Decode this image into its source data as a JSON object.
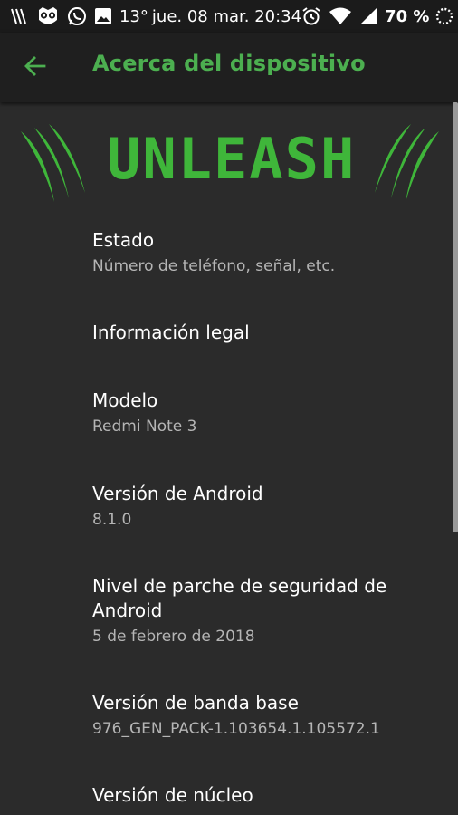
{
  "status_bar": {
    "temperature": "13°",
    "datetime": "jue. 08 mar. 20:34",
    "battery": "70 %",
    "icons": [
      "claw-icon",
      "owl-icon",
      "whatsapp-icon",
      "image-icon",
      "alarm-icon",
      "wifi-icon",
      "signal-icon",
      "loading-icon"
    ]
  },
  "app_bar": {
    "title": "Acerca del dispositivo",
    "back_icon": "arrow-back-icon",
    "accent_color": "#4caf50"
  },
  "banner": {
    "text": "UNLEASH",
    "color": "#3fb63a"
  },
  "items": [
    {
      "title": "Estado",
      "subtitle": "Número de teléfono, señal, etc."
    },
    {
      "title": "Información legal"
    },
    {
      "title": "Modelo",
      "subtitle": "Redmi Note 3"
    },
    {
      "title": "Versión de Android",
      "subtitle": "8.1.0"
    },
    {
      "title": "Nivel de parche de seguridad de Android",
      "subtitle": "5 de febrero de 2018"
    },
    {
      "title": "Versión de banda base",
      "subtitle": "976_GEN_PACK-1.103654.1.105572.1"
    },
    {
      "title": "Versión de núcleo",
      "subtitle": ""
    }
  ]
}
